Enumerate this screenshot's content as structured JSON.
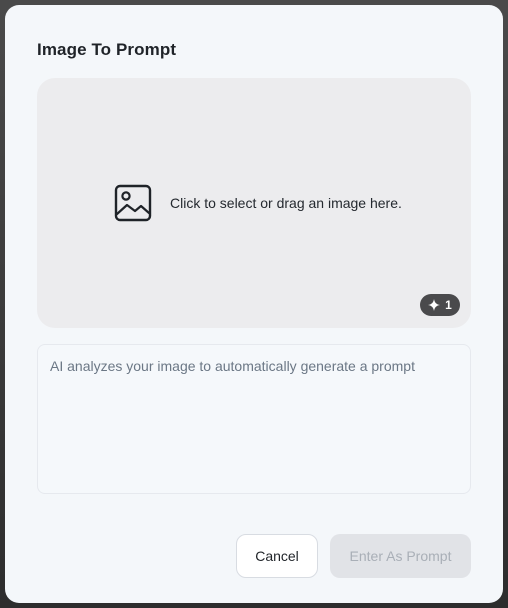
{
  "dialog": {
    "title": "Image To Prompt"
  },
  "upload": {
    "instruction": "Click to select or drag an image here.",
    "icon": "image-icon",
    "credit_badge": {
      "icon": "sparkle-icon",
      "count": "1"
    }
  },
  "prompt": {
    "value": "",
    "placeholder": "AI analyzes your image to automatically generate a prompt"
  },
  "actions": {
    "cancel_label": "Cancel",
    "enter_label": "Enter As Prompt",
    "enter_disabled": true
  },
  "colors": {
    "modal_bg": "#f4f7fa",
    "dropzone_bg": "#ececee",
    "badge_bg": "#4a4a4c",
    "disabled_button_bg": "#e1e3e7",
    "disabled_button_text": "#a9afb7"
  }
}
